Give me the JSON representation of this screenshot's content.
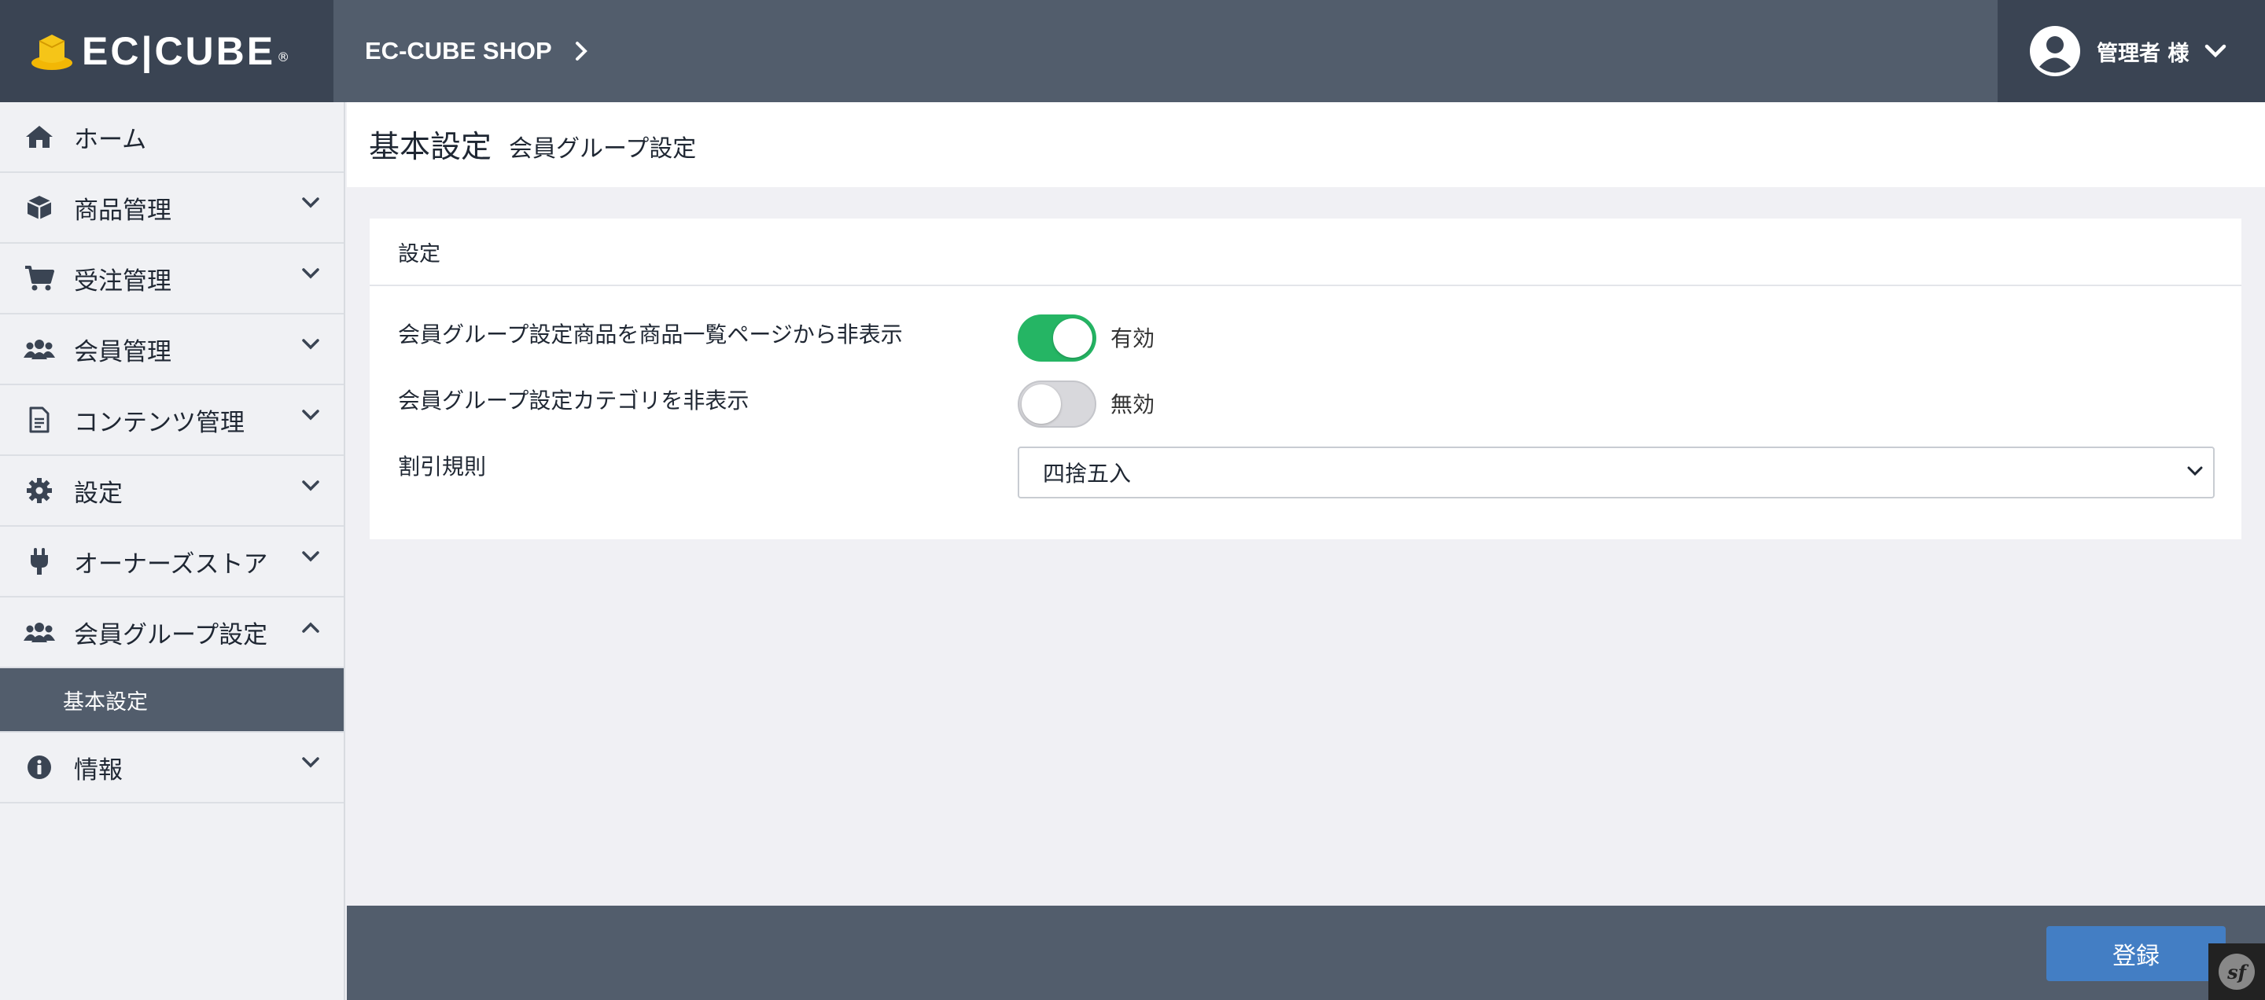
{
  "header": {
    "logo_text": "EC|CUBE",
    "shop_name": "EC-CUBE SHOP",
    "user_label": "管理者 様"
  },
  "sidebar": {
    "items": [
      {
        "label": "ホーム",
        "icon": "home-icon"
      },
      {
        "label": "商品管理",
        "icon": "box-icon"
      },
      {
        "label": "受注管理",
        "icon": "cart-icon"
      },
      {
        "label": "会員管理",
        "icon": "users-icon"
      },
      {
        "label": "コンテンツ管理",
        "icon": "file-icon"
      },
      {
        "label": "設定",
        "icon": "gear-icon"
      },
      {
        "label": "オーナーズストア",
        "icon": "plug-icon"
      },
      {
        "label": "会員グループ設定",
        "icon": "users-icon"
      },
      {
        "label": "情報",
        "icon": "info-icon"
      }
    ],
    "subitem": "基本設定"
  },
  "page": {
    "title": "基本設定",
    "subtitle": "会員グループ設定"
  },
  "card": {
    "header": "設定",
    "rows": [
      {
        "label": "会員グループ設定商品を商品一覧ページから非表示",
        "toggle_on": true,
        "toggle_label": "有効"
      },
      {
        "label": "会員グループ設定カテゴリを非表示",
        "toggle_on": false,
        "toggle_label": "無効"
      },
      {
        "label": "割引規則",
        "select_value": "四捨五入"
      }
    ]
  },
  "footer": {
    "save_label": "登録"
  },
  "colors": {
    "header_bg": "#525d6c",
    "logo_bg": "#3a4453",
    "toggle_on": "#25b564",
    "button": "#437ec4"
  }
}
